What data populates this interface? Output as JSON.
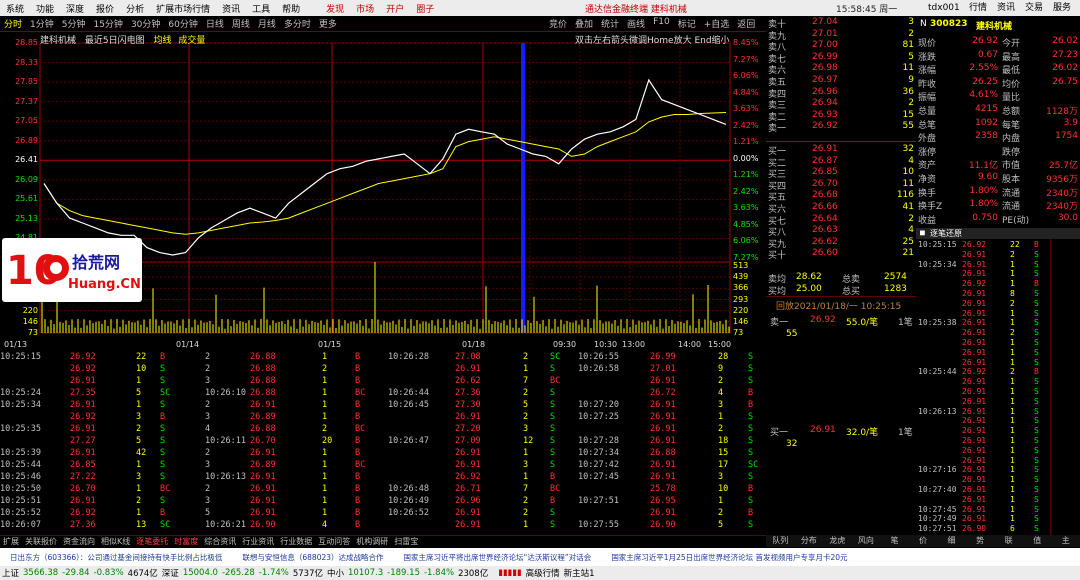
{
  "menu": {
    "items": [
      "系统",
      "功能",
      "深度",
      "报价",
      "分析",
      "扩展市场行情",
      "资讯",
      "工具",
      "帮助"
    ],
    "center": [
      "发现",
      "市场",
      "开户",
      "圈子"
    ],
    "title": "通达信金融终端  建科机械",
    "time": "15:58:45 周一",
    "user": "tdx001",
    "right": [
      "行情",
      "资讯",
      "交易",
      "服务"
    ]
  },
  "toolbar": {
    "periods": [
      "分时",
      "1分钟",
      "5分钟",
      "15分钟",
      "30分钟",
      "60分钟",
      "日线",
      "周线",
      "月线",
      "多分时",
      "更多"
    ],
    "active": "分时",
    "tools": [
      "竞价",
      "叠加",
      "统计",
      "画线",
      "F10",
      "标记",
      "+自选",
      "返回"
    ]
  },
  "chart_head": {
    "name": "建科机械",
    "mode": "最近5日闪电图",
    "avg": "均线",
    "vol": "成交量",
    "hint": "双击左右箭头微调Home放大 End缩小"
  },
  "chart_data": {
    "type": "line",
    "title": "建科机械 最近5日闪电图",
    "x": [
      "01/13",
      "01/14",
      "01/15",
      "01/18",
      "09:30",
      "10:30",
      "13:00",
      "14:00",
      "15:00"
    ],
    "y_left": [
      "28.85",
      "28.33",
      "27.85",
      "27.37",
      "27.05",
      "26.89",
      "26.41",
      "26.09",
      "25.61",
      "25.13",
      "24.81",
      "24.49"
    ],
    "y_right": [
      "8.45%",
      "7.27%",
      "6.06%",
      "4.84%",
      "3.63%",
      "2.42%",
      "1.21%",
      "0.00%",
      "1.21%",
      "2.42%",
      "3.63%",
      "4.85%",
      "6.06%",
      "7.27%"
    ],
    "vol_left": [
      "513",
      "439",
      "366",
      "293",
      "220",
      "146",
      "73"
    ],
    "vol_right": [
      "513",
      "439",
      "366",
      "293",
      "220",
      "146",
      "73"
    ],
    "price": [
      26.0,
      25.6,
      25.3,
      25.2,
      25.1,
      25.0,
      24.95,
      24.95,
      24.7,
      24.6,
      24.55,
      24.6,
      24.9,
      25.1,
      25.25,
      25.4,
      25.5,
      25.4,
      25.3,
      25.6,
      25.8,
      26.0,
      26.2,
      26.3,
      26.35,
      26.45,
      26.5,
      26.55,
      26.6,
      26.4,
      26.2,
      26.5,
      27.0,
      27.1,
      27.05,
      27.0,
      26.8,
      26.7,
      26.6,
      26.55,
      26.4,
      26.7,
      26.9,
      27.0,
      27.05,
      27.15,
      27.3,
      28.1,
      27.7,
      27.6,
      27.5,
      27.4,
      27.3,
      27.2
    ],
    "avg": [
      26.0,
      25.6,
      25.45,
      25.35,
      25.3,
      25.25,
      25.2,
      25.15,
      25.1,
      25.05,
      25.0,
      24.97,
      25.0,
      25.05,
      25.1,
      25.15,
      25.2,
      25.22,
      25.25,
      25.3,
      25.4,
      25.5,
      25.6,
      25.7,
      25.8,
      25.9,
      26.0,
      26.05,
      26.1,
      26.15,
      26.2,
      26.3,
      26.75,
      26.85,
      26.9,
      26.95,
      26.9,
      26.85,
      26.8,
      26.75,
      26.7,
      26.55,
      26.6,
      26.75,
      26.85,
      26.95,
      27.05,
      27.25,
      27.35,
      27.4,
      27.4,
      27.42,
      27.43,
      27.44
    ]
  },
  "stock": {
    "code": "300823",
    "name": "建科机械"
  },
  "orderbook": {
    "asks": [
      [
        "卖十",
        "27.04",
        "3"
      ],
      [
        "卖九",
        "27.01",
        "2"
      ],
      [
        "卖八",
        "27.00",
        "81"
      ],
      [
        "卖七",
        "26.99",
        "5"
      ],
      [
        "卖六",
        "26.98",
        "11"
      ],
      [
        "卖五",
        "26.97",
        "9"
      ],
      [
        "卖四",
        "26.96",
        "36"
      ],
      [
        "卖三",
        "26.94",
        "2"
      ],
      [
        "卖二",
        "26.93",
        "15"
      ],
      [
        "卖一",
        "26.92",
        "55"
      ]
    ],
    "bids": [
      [
        "买一",
        "26.91",
        "32"
      ],
      [
        "买二",
        "26.87",
        "4"
      ],
      [
        "买三",
        "26.85",
        "10"
      ],
      [
        "买四",
        "26.70",
        "11"
      ],
      [
        "买五",
        "26.68",
        "116"
      ],
      [
        "买六",
        "26.66",
        "41"
      ],
      [
        "买七",
        "26.64",
        "2"
      ],
      [
        "买八",
        "26.63",
        "4"
      ],
      [
        "买九",
        "26.62",
        "25"
      ],
      [
        "买十",
        "26.60",
        "21"
      ]
    ],
    "avg_ask": [
      "卖均",
      "28.62",
      "总卖",
      "2574"
    ],
    "avg_bid": [
      "买均",
      "25.00",
      "总买",
      "1283"
    ]
  },
  "info": [
    [
      "现价",
      "26.92",
      "今开",
      "26.02"
    ],
    [
      "涨跌",
      "0.67",
      "最高",
      "27.23"
    ],
    [
      "涨幅",
      "2.55%",
      "最低",
      "26.02"
    ],
    [
      "昨收",
      "26.25",
      "均价",
      "26.75"
    ],
    [
      "振幅",
      "4.61%",
      "量比",
      ""
    ],
    [
      "总量",
      "4215",
      "总额",
      "1128万"
    ],
    [
      "总笔",
      "1092",
      "每笔",
      "3.9"
    ],
    [
      "外盘",
      "2358",
      "内盘",
      "1754"
    ],
    [
      "涨停",
      "",
      "跌停",
      ""
    ],
    [
      "资产",
      "11.1亿",
      "市值",
      "25.7亿"
    ],
    [
      "净资",
      "9.60",
      "股本",
      "9356万"
    ],
    [
      "换手",
      "1.80%",
      "流通",
      "2340万"
    ],
    [
      "换手Z",
      "1.80%",
      "流通",
      "2340万"
    ],
    [
      "收益",
      "0.750",
      "PE(动)",
      "30.0"
    ]
  ],
  "replay": {
    "title": "回放2021/01/18/一 10:25:15",
    "sell": [
      "卖一",
      "26.92",
      "55.0/笔",
      "1笔"
    ],
    "sell_q": "55",
    "buy": [
      "买一",
      "26.91",
      "32.0/笔",
      "1笔"
    ],
    "buy_q": "32"
  },
  "tick_title": "逐笔还原",
  "ticks": [
    [
      "10:25:15",
      "26.92",
      "22",
      "B"
    ],
    [
      "",
      "26.91",
      "2",
      "S"
    ],
    [
      "10:25:34",
      "26.91",
      "1",
      "S"
    ],
    [
      "",
      "26.91",
      "1",
      "S"
    ],
    [
      "",
      "26.92",
      "1",
      "B"
    ],
    [
      "",
      "26.91",
      "8",
      "S"
    ],
    [
      "",
      "26.91",
      "2",
      "S"
    ],
    [
      "",
      "26.91",
      "1",
      "S"
    ],
    [
      "10:25:38",
      "26.91",
      "1",
      "S"
    ],
    [
      "",
      "26.91",
      "2",
      "S"
    ],
    [
      "",
      "26.91",
      "1",
      "S"
    ],
    [
      "",
      "26.91",
      "1",
      "S"
    ],
    [
      "",
      "26.91",
      "1",
      "S"
    ],
    [
      "10:25:44",
      "26.92",
      "2",
      "B"
    ],
    [
      "",
      "26.91",
      "1",
      "S"
    ],
    [
      "",
      "26.91",
      "1",
      "S"
    ],
    [
      "",
      "26.91",
      "1",
      "S"
    ],
    [
      "10:26:13",
      "26.91",
      "1",
      "S"
    ],
    [
      "",
      "26.91",
      "1",
      "S"
    ],
    [
      "",
      "26.91",
      "1",
      "S"
    ],
    [
      "",
      "26.91",
      "1",
      "S"
    ],
    [
      "",
      "26.91",
      "1",
      "S"
    ],
    [
      "",
      "26.91",
      "1",
      "S"
    ],
    [
      "10:27:16",
      "26.91",
      "1",
      "S"
    ],
    [
      "",
      "26.91",
      "1",
      "S"
    ],
    [
      "10:27:40",
      "26.91",
      "1",
      "S"
    ],
    [
      "",
      "26.91",
      "1",
      "S"
    ],
    [
      "10:27:45",
      "26.91",
      "1",
      "S"
    ],
    [
      "10:27:49",
      "26.91",
      "1",
      "S"
    ],
    [
      "10:27:51",
      "26.90",
      "6",
      "S"
    ]
  ],
  "trades": [
    [
      "10:25:15",
      "26.92",
      "22",
      "B",
      "2",
      "26.88",
      "1",
      "B",
      "10:26:28",
      "27.08",
      "2",
      "SC",
      "10:26:55",
      "26.99",
      "28",
      "S"
    ],
    [
      "",
      "26.92",
      "10",
      "S",
      "2",
      "26.88",
      "2",
      "B",
      "",
      "26.91",
      "1",
      "S",
      "10:26:58",
      "27.01",
      "9",
      "S"
    ],
    [
      "",
      "26.91",
      "1",
      "S",
      "3",
      "26.88",
      "1",
      "B",
      "",
      "26.62",
      "7",
      "BC",
      "",
      "26.91",
      "2",
      "S"
    ],
    [
      "10:25:24",
      "27.35",
      "5",
      "SC",
      "10:26:10",
      "26.88",
      "1",
      "BC",
      "10:26:44",
      "27.36",
      "2",
      "S",
      "",
      "26.72",
      "4",
      "B"
    ],
    [
      "10:25:34",
      "26.91",
      "1",
      "S",
      "2",
      "26.91",
      "1",
      "B",
      "10:26:45",
      "27.30",
      "5",
      "S",
      "10:27:20",
      "26.91",
      "3",
      "B"
    ],
    [
      "",
      "26.92",
      "3",
      "B",
      "3",
      "26.89",
      "1",
      "B",
      "",
      "26.91",
      "2",
      "S",
      "10:27:25",
      "26.91",
      "1",
      "S"
    ],
    [
      "10:25:35",
      "26.91",
      "2",
      "S",
      "4",
      "26.88",
      "2",
      "BC",
      "",
      "27.20",
      "3",
      "S",
      "",
      "26.91",
      "2",
      "S"
    ],
    [
      "",
      "27.27",
      "5",
      "S",
      "10:26:11",
      "26.70",
      "20",
      "B",
      "10:26:47",
      "27.09",
      "12",
      "S",
      "10:27:28",
      "26.91",
      "18",
      "S"
    ],
    [
      "10:25:39",
      "26.91",
      "42",
      "S",
      "2",
      "26.91",
      "1",
      "B",
      "",
      "26.91",
      "1",
      "S",
      "10:27:34",
      "26.88",
      "15",
      "S"
    ],
    [
      "10:25:44",
      "26.85",
      "1",
      "S",
      "3",
      "26.89",
      "1",
      "BC",
      "",
      "26.91",
      "3",
      "S",
      "10:27:42",
      "26.91",
      "17",
      "SC"
    ],
    [
      "10:25:46",
      "27.22",
      "3",
      "S",
      "10:26:13",
      "26.91",
      "1",
      "B",
      "",
      "26.92",
      "1",
      "B",
      "10:27:45",
      "26.91",
      "3",
      "S"
    ],
    [
      "10:25:50",
      "26.70",
      "1",
      "BC",
      "2",
      "26.91",
      "1",
      "B",
      "10:26:48",
      "26.71",
      "7",
      "BC",
      "",
      "25.78",
      "10",
      "B"
    ],
    [
      "10:25:51",
      "26.91",
      "2",
      "S",
      "3",
      "26.91",
      "1",
      "B",
      "10:26:49",
      "26.96",
      "2",
      "B",
      "10:27:51",
      "26.95",
      "1",
      "S"
    ],
    [
      "10:25:52",
      "26.92",
      "1",
      "B",
      "5",
      "26.91",
      "1",
      "B",
      "10:26:52",
      "26.91",
      "2",
      "S",
      "",
      "26.91",
      "2",
      "B"
    ],
    [
      "10:26:07",
      "27.36",
      "13",
      "SC",
      "10:26:21",
      "26.90",
      "4",
      "B",
      "",
      "26.91",
      "1",
      "S",
      "10:27:55",
      "26.90",
      "5",
      "S"
    ]
  ],
  "bottom_tabs": [
    "扩展",
    "关联报价",
    "资金流向",
    "相似K线",
    "逐笔委托",
    "时富度",
    "综合资讯",
    "行业资讯",
    "行业数据",
    "互动问答",
    "机构调研",
    "扫雷宝"
  ],
  "right_tabs": [
    "队列",
    "分布",
    "龙虎",
    "风向",
    "笔",
    "价",
    "细",
    "势",
    "联",
    "值",
    "主"
  ],
  "news": [
    "日出东方（603366）：公司通过基金间接持有快手比例占比极低",
    "联想与安恒信息（688023）达成战略合作",
    "国家主席习近平将出席世界经济论坛“达沃斯议程”对话会",
    "国家主席习近平1月25日出席世界经济论坛 首发视频用户专享月卡20元"
  ],
  "status": {
    "sh": [
      "上证",
      "3566.38",
      "-29.84",
      "-0.83%",
      "4674亿"
    ],
    "sz": [
      "深证",
      "15004.0",
      "-265.28",
      "-1.74%",
      "5737亿"
    ],
    "zx": [
      "中小",
      "10107.3",
      "-189.15",
      "-1.84%",
      "2308亿"
    ],
    "tail": [
      "高级行情",
      "新主站1"
    ]
  }
}
